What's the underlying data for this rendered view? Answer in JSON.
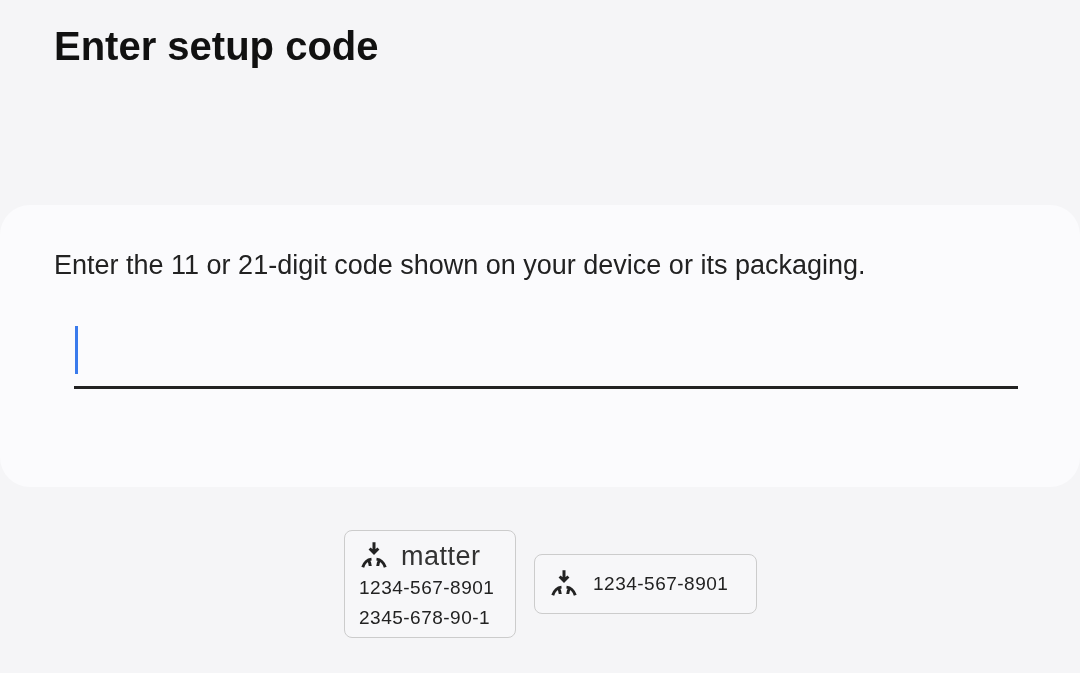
{
  "title": "Enter setup code",
  "instruction": "Enter the 11 or 21-digit code shown on your device or its packaging.",
  "code_field": {
    "focused": true
  },
  "example_labels": [
    {
      "kind": "full",
      "brand": "matter",
      "codes": [
        "1234-567-8901",
        "2345-678-90-1"
      ]
    },
    {
      "kind": "compact",
      "codes": [
        "1234-567-8901"
      ]
    }
  ]
}
